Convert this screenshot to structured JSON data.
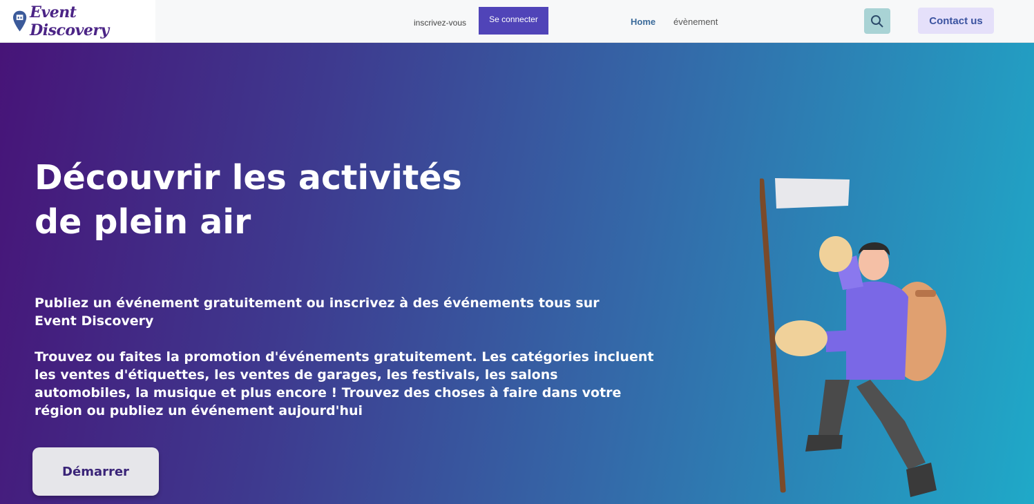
{
  "header": {
    "logo_text": "Event Discovery",
    "signup_label": "inscrivez-vous",
    "login_label": "Se connecter",
    "nav": [
      {
        "label": "Home"
      },
      {
        "label": "évènement"
      }
    ],
    "search_icon": "search-icon",
    "contact_label": "Contact us"
  },
  "hero": {
    "title": " Découvrir les activités\nde plein air",
    "paragraph1": "Publiez un événement  gratuitement ou inscrivez à des événements tous sur Event Discovery",
    "paragraph2": "Trouvez ou faites la promotion d'événements gratuitement. Les catégories incluent les ventes d'étiquettes, les ventes de garages, les festivals, les salons automobiles, la musique et plus encore ! Trouvez des choses à faire dans votre région ou publiez un événement aujourd'hui",
    "cta_label": "Démarrer"
  },
  "colors": {
    "brand_purple": "#4b2486",
    "login_button": "#5044b8",
    "contact_bg": "#e5e0fa",
    "search_bg": "#a9d3d5",
    "gradient_start": "#471478",
    "gradient_end": "#1fa9c8"
  }
}
